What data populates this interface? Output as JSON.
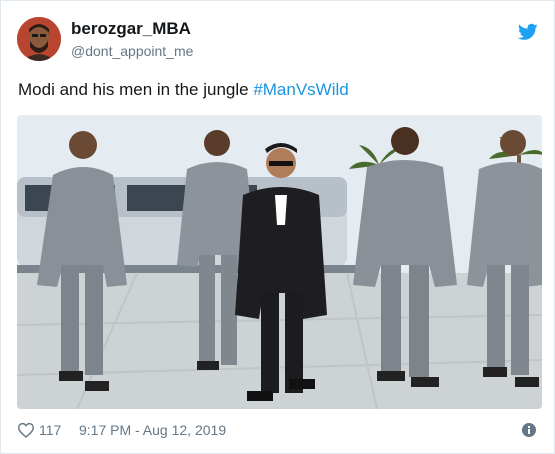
{
  "user": {
    "display_name": "berozgar_MBA",
    "handle": "@dont_appoint_me"
  },
  "tweet": {
    "text": "Modi and his men in the jungle ",
    "hashtag": "#ManVsWild"
  },
  "footer": {
    "like_count": "117",
    "timestamp": "9:17 PM - Aug 12, 2019"
  },
  "colors": {
    "brand_blue": "#1da1f2",
    "hashtag_blue": "#1b95e0",
    "muted_gray": "#657786"
  },
  "icons": [
    "twitter-bird-icon",
    "heart-icon",
    "info-icon"
  ]
}
